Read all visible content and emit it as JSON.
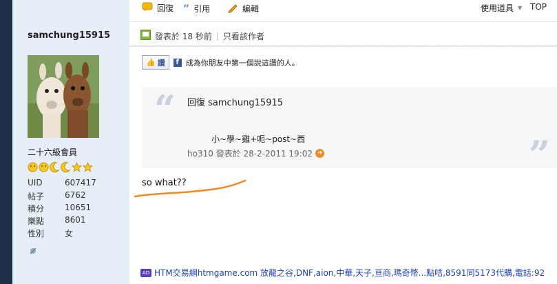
{
  "profile": {
    "username": "samchung15915",
    "rank": "二十六級會員",
    "stats": [
      {
        "label": "UID",
        "value": "607417"
      },
      {
        "label": "帖子",
        "value": "6762"
      },
      {
        "label": "積分",
        "value": "10651"
      },
      {
        "label": "樂點",
        "value": "8601"
      },
      {
        "label": "性別",
        "value": "女"
      }
    ],
    "rank_icons": [
      "sun-icon",
      "sun-icon",
      "moon-icon",
      "moon-icon",
      "star-icon",
      "star-icon"
    ]
  },
  "toolbar": {
    "reply": "回復",
    "quote": "引用",
    "edit": "編輯",
    "tools": "使用道具",
    "top": "TOP"
  },
  "post_meta": {
    "posted": "發表於 18 秒前",
    "author_only": "只看該作者"
  },
  "like": {
    "button": "讚",
    "text": "成為你朋友中第一個說這讚的人。"
  },
  "quote": {
    "header": "回復  samchung15915",
    "body": "小~學~雞+呃~post~西",
    "footer": "ho310 發表於 28-2-2011 19:02"
  },
  "post": {
    "content": "so what??"
  },
  "ad": {
    "text": "HTM交易網htmgame.com 放龍之谷,DNF,aion,中華,天子,亘商,瑪奇幣...點咭,8591同5173代購,電話:92"
  },
  "colors": {
    "sidebar_dark": "#1c3049",
    "profile_bg": "#e6eef7",
    "accent_orange": "#f08a1e",
    "link_blue": "#1a3fbd"
  }
}
